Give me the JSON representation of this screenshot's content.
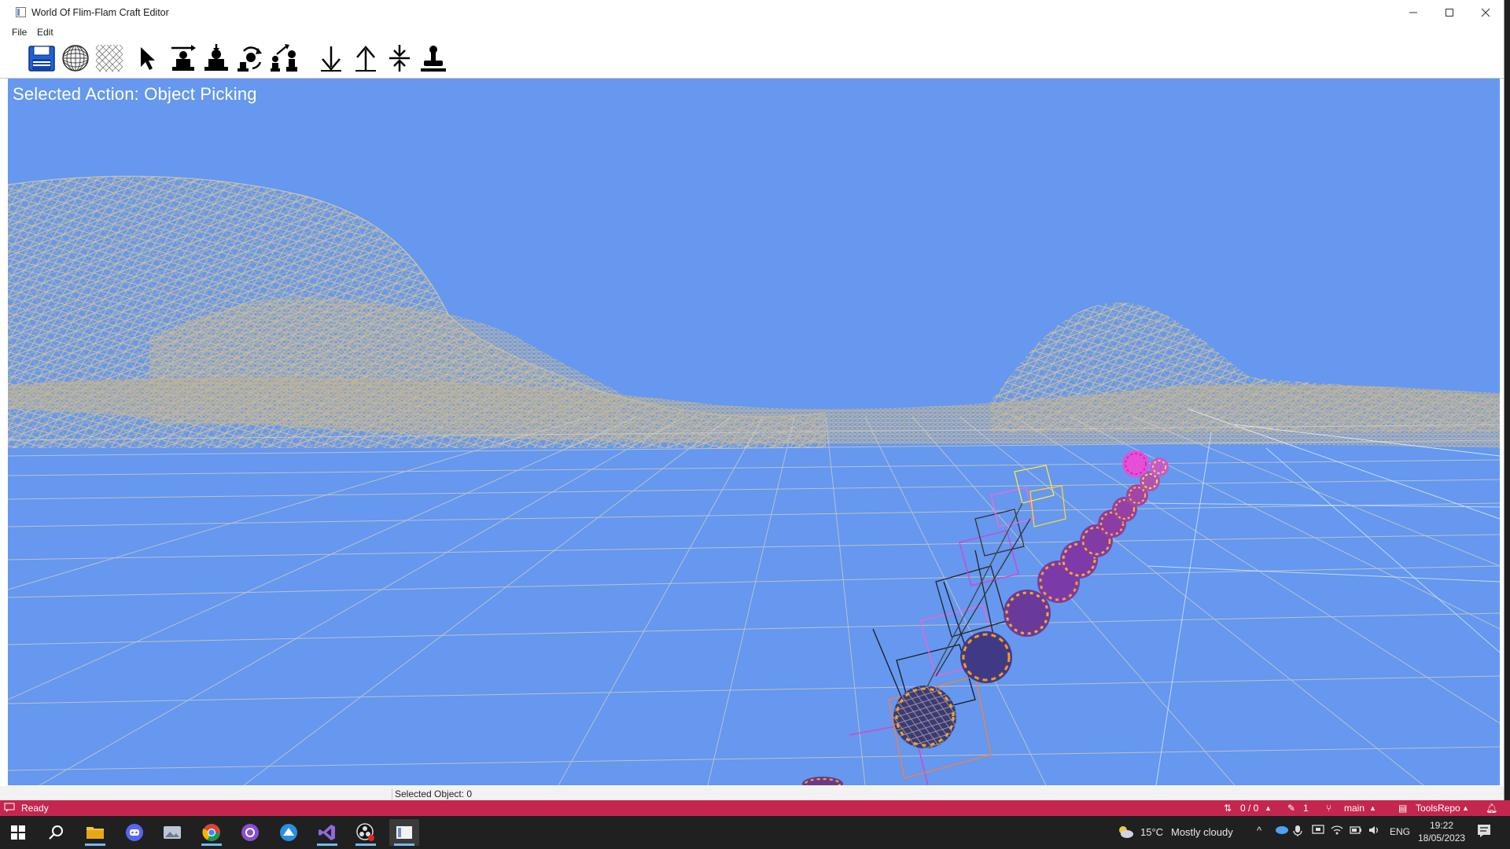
{
  "window": {
    "title": "World Of Flim-Flam Craft Editor"
  },
  "menu": {
    "items": [
      {
        "label": "File"
      },
      {
        "label": "Edit"
      }
    ]
  },
  "toolbar": {
    "tools": [
      {
        "icon": "floppy-disk-icon",
        "name": "save"
      },
      {
        "icon": "wireframe-sphere-icon",
        "name": "sphere"
      },
      {
        "icon": "mesh-grid-icon",
        "name": "terrain-grid"
      },
      {
        "icon": "cursor-arrow-icon",
        "name": "object-picking"
      },
      {
        "icon": "raise-terrain-icon",
        "name": "raise"
      },
      {
        "icon": "place-object-icon",
        "name": "place"
      },
      {
        "icon": "rotate-object-icon",
        "name": "rotate"
      },
      {
        "icon": "scale-object-icon",
        "name": "scale"
      },
      {
        "icon": "arrow-down-icon",
        "name": "lower"
      },
      {
        "icon": "arrow-up-icon",
        "name": "lift"
      },
      {
        "icon": "flatten-icon",
        "name": "flatten"
      },
      {
        "icon": "stamp-icon",
        "name": "stamp"
      }
    ]
  },
  "viewport": {
    "selected_action": "Selected Action: Object Picking",
    "sky_color": "#6598ee",
    "mesh_color": "#c9b893"
  },
  "status": {
    "selected_object": "Selected Object: 0"
  },
  "vs_status": {
    "ready": "Ready",
    "sync": "0 / 0",
    "pending": "1",
    "branch": "main",
    "repo": "ToolsRepo",
    "color": "#c5264f"
  },
  "taskbar": {
    "weather_temp": "15°C",
    "weather_text": "Mostly cloudy",
    "language": "ENG",
    "time": "19:22",
    "date": "18/05/2023"
  }
}
